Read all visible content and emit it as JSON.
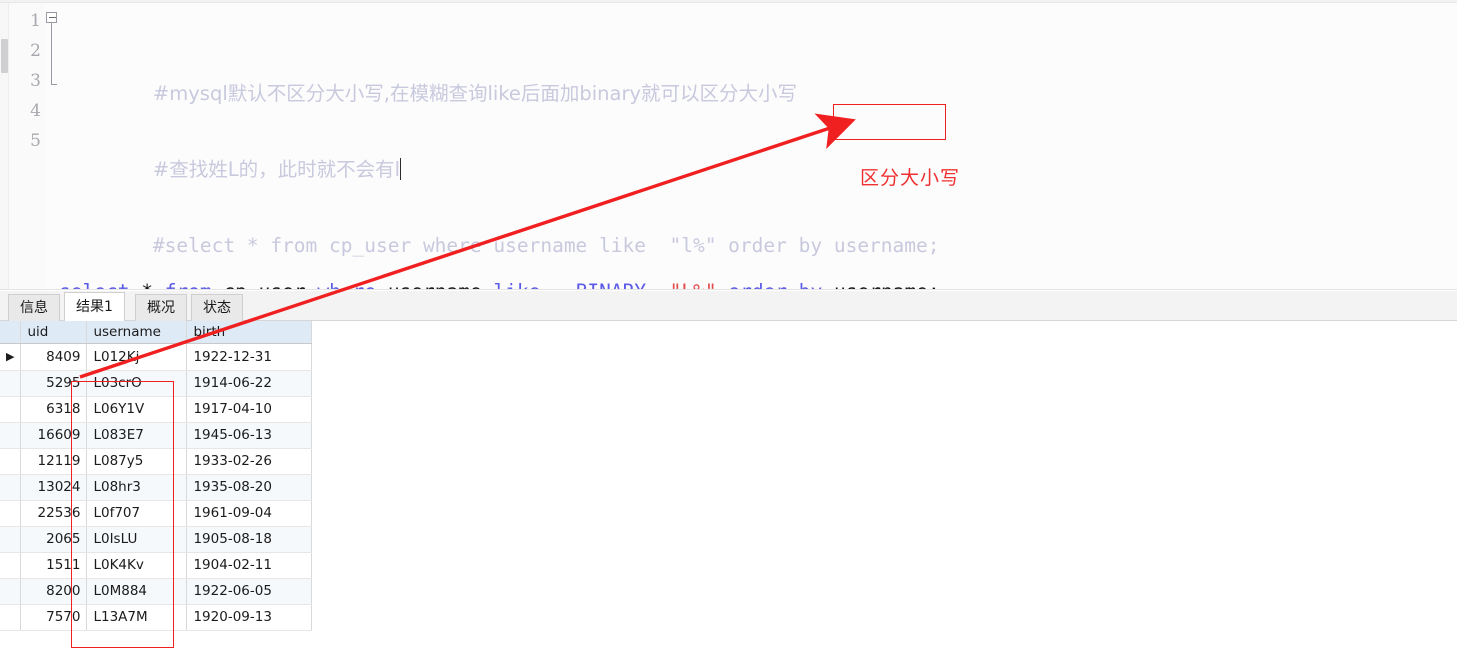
{
  "editor": {
    "lines": [
      {
        "number": "1",
        "commented": true,
        "text": "#mysql默认不区分大小写,在模糊查询like后面加binary就可以区分大小写"
      },
      {
        "number": "2",
        "commented": true,
        "text": "#查找姓L的，此时就不会有l",
        "caret": true
      },
      {
        "number": "3",
        "commented": true,
        "text": "#select * from cp_user where username like  \"l%\" order by username;"
      },
      {
        "number": "4",
        "commented": false,
        "text": "select * from cp_user where username like  BINARY \"L%\" order by username;",
        "tokens": [
          {
            "t": "select",
            "k": "kw"
          },
          {
            "t": " ",
            "k": "sp"
          },
          {
            "t": "*",
            "k": "op"
          },
          {
            "t": " ",
            "k": "sp"
          },
          {
            "t": "from",
            "k": "kw"
          },
          {
            "t": " ",
            "k": "sp"
          },
          {
            "t": "cp_user",
            "k": "id"
          },
          {
            "t": " ",
            "k": "sp"
          },
          {
            "t": "where",
            "k": "kw"
          },
          {
            "t": " ",
            "k": "sp"
          },
          {
            "t": "username",
            "k": "id"
          },
          {
            "t": " ",
            "k": "sp"
          },
          {
            "t": "like",
            "k": "kw"
          },
          {
            "t": "   ",
            "k": "sp"
          },
          {
            "t": "BINARY",
            "k": "kw"
          },
          {
            "t": "  ",
            "k": "sp"
          },
          {
            "t": "\"L%\"",
            "k": "str"
          },
          {
            "t": " ",
            "k": "sp"
          },
          {
            "t": "order",
            "k": "kw"
          },
          {
            "t": " ",
            "k": "sp"
          },
          {
            "t": "by",
            "k": "kw"
          },
          {
            "t": " ",
            "k": "sp"
          },
          {
            "t": "username",
            "k": "id"
          },
          {
            "t": ";",
            "k": "punct"
          }
        ]
      },
      {
        "number": "5",
        "commented": false,
        "text": ""
      }
    ],
    "fold_marker_icon": "fold-collapse-icon"
  },
  "annotation": {
    "label": "区分大小写",
    "color": "#f03030",
    "arrow_icon": "arrow-pointer-icon",
    "highlight_keyword": "BINARY"
  },
  "results": {
    "tabs": [
      {
        "label": "信息",
        "active": false
      },
      {
        "label": "结果1",
        "active": true
      },
      {
        "label": "概况",
        "active": false
      },
      {
        "label": "状态",
        "active": false
      }
    ],
    "columns": [
      "uid",
      "username",
      "birth"
    ],
    "rows": [
      {
        "marker": "▶",
        "uid": "8409",
        "username": "L012Kj",
        "birth": "1922-12-31"
      },
      {
        "marker": "",
        "uid": "5295",
        "username": "L03crO",
        "birth": "1914-06-22"
      },
      {
        "marker": "",
        "uid": "6318",
        "username": "L06Y1V",
        "birth": "1917-04-10"
      },
      {
        "marker": "",
        "uid": "16609",
        "username": "L083E7",
        "birth": "1945-06-13"
      },
      {
        "marker": "",
        "uid": "12119",
        "username": "L087y5",
        "birth": "1933-02-26"
      },
      {
        "marker": "",
        "uid": "13024",
        "username": "L08hr3",
        "birth": "1935-08-20"
      },
      {
        "marker": "",
        "uid": "22536",
        "username": "L0f707",
        "birth": "1961-09-04"
      },
      {
        "marker": "",
        "uid": "2065",
        "username": "L0IsLU",
        "birth": "1905-08-18"
      },
      {
        "marker": "",
        "uid": "1511",
        "username": "L0K4Kv",
        "birth": "1904-02-11"
      },
      {
        "marker": "",
        "uid": "8200",
        "username": "L0M884",
        "birth": "1922-06-05"
      },
      {
        "marker": "",
        "uid": "7570",
        "username": "L13A7M",
        "birth": "1920-09-13"
      }
    ]
  },
  "colors": {
    "keyword": "#5a5ae6",
    "string": "#e04a4a",
    "comment": "#c8c9dd",
    "annotation": "#f03030",
    "header_bg": "#dfeaf7"
  }
}
